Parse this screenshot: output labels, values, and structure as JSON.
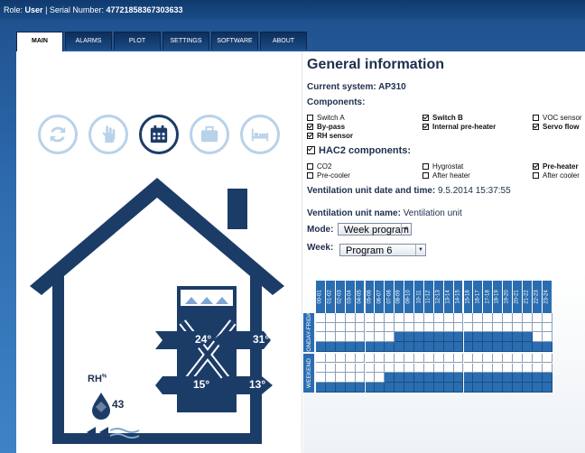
{
  "topbar": {
    "role_label": "Role:",
    "role_value": "User",
    "sep": "|",
    "serial_label": "Serial Number:",
    "serial_value": "47721858367303633"
  },
  "tabs": [
    {
      "label": "MAIN",
      "active": true
    },
    {
      "label": "ALARMS"
    },
    {
      "label": "PLOT"
    },
    {
      "label": "SETTINGS"
    },
    {
      "label": "SOFTWARE"
    },
    {
      "label": "ABOUT"
    }
  ],
  "mode_buttons": [
    {
      "icon": "refresh-icon"
    },
    {
      "icon": "hand-icon"
    },
    {
      "icon": "calendar-icon",
      "active": true
    },
    {
      "icon": "suitcase-icon"
    },
    {
      "icon": "bed-icon"
    }
  ],
  "house": {
    "temp_top_left": "24°",
    "temp_top_right": "31°",
    "temp_bottom_left": "15°",
    "temp_bottom_right": "13°",
    "rh_label": "RH",
    "rh_unit": "%",
    "rh_value": "43"
  },
  "info": {
    "title": "General information",
    "current_system_label": "Current system:",
    "current_system_value": "AP310",
    "components_label": "Components:",
    "components": [
      {
        "label": "Switch A",
        "checked": false
      },
      {
        "label": "Switch B",
        "checked": true
      },
      {
        "label": "VOC sensor",
        "checked": false
      },
      {
        "label": "By-pass",
        "checked": true
      },
      {
        "label": "Internal pre-heater",
        "checked": true
      },
      {
        "label": "Servo flow",
        "checked": true
      },
      {
        "label": "RH sensor",
        "checked": true
      }
    ],
    "hac2_label": "HAC2 components:",
    "hac2_checked": true,
    "hac2": [
      {
        "label": "CO2",
        "checked": false
      },
      {
        "label": "Hygrostat",
        "checked": false
      },
      {
        "label": "Pre-heater",
        "checked": true
      },
      {
        "label": "Pre-cooler",
        "checked": false
      },
      {
        "label": "After heater",
        "checked": false
      },
      {
        "label": "After cooler",
        "checked": false
      }
    ],
    "datetime_label": "Ventilation unit date and time:",
    "datetime_value": "9.5.2014 15:37:55",
    "unitname_label": "Ventilation unit name:",
    "unitname_value": "Ventilation unit",
    "mode_label": "Mode:",
    "mode_value": "Week program",
    "week_label": "Week:",
    "week_value": "Program 6"
  },
  "schedule": {
    "hours": [
      "00-01",
      "01-02",
      "02-03",
      "03-04",
      "04-05",
      "05-06",
      "06-07",
      "07-08",
      "08-09",
      "09-10",
      "10-11",
      "11-12",
      "12-13",
      "13-14",
      "14-15",
      "15-16",
      "16-17",
      "17-18",
      "18-19",
      "19-20",
      "20-21",
      "21-22",
      "22-23",
      "23-24"
    ],
    "weekday_label": "MONDAY-FRIDAY",
    "weekend_label": "WEEKEND",
    "weekday_rows": [
      [
        0,
        0,
        0,
        0,
        0,
        0,
        0,
        0,
        0,
        0,
        0,
        0,
        0,
        0,
        0,
        0,
        0,
        0,
        0,
        0,
        0,
        0,
        0,
        0
      ],
      [
        0,
        0,
        0,
        0,
        0,
        0,
        0,
        0,
        0,
        0,
        0,
        0,
        0,
        0,
        0,
        0,
        0,
        0,
        0,
        0,
        0,
        0,
        0,
        0
      ],
      [
        0,
        0,
        0,
        0,
        0,
        0,
        0,
        0,
        1,
        1,
        1,
        1,
        1,
        1,
        1,
        1,
        1,
        1,
        1,
        1,
        1,
        1,
        0,
        0
      ],
      [
        1,
        1,
        1,
        1,
        1,
        1,
        1,
        1,
        1,
        1,
        1,
        1,
        1,
        1,
        1,
        1,
        1,
        1,
        1,
        1,
        1,
        1,
        1,
        1
      ]
    ],
    "weekend_rows": [
      [
        0,
        0,
        0,
        0,
        0,
        0,
        0,
        0,
        0,
        0,
        0,
        0,
        0,
        0,
        0,
        0,
        0,
        0,
        0,
        0,
        0,
        0,
        0,
        0
      ],
      [
        0,
        0,
        0,
        0,
        0,
        0,
        0,
        0,
        0,
        0,
        0,
        0,
        0,
        0,
        0,
        0,
        0,
        0,
        0,
        0,
        0,
        0,
        0,
        0
      ],
      [
        0,
        0,
        0,
        0,
        0,
        0,
        0,
        1,
        1,
        1,
        1,
        1,
        1,
        1,
        1,
        1,
        1,
        1,
        1,
        1,
        1,
        1,
        1,
        1
      ],
      [
        1,
        1,
        1,
        1,
        1,
        1,
        1,
        1,
        1,
        1,
        1,
        1,
        1,
        1,
        1,
        1,
        1,
        1,
        1,
        1,
        1,
        1,
        1,
        1
      ]
    ]
  },
  "colors": {
    "accent": "#2a6db0",
    "house": "#1c3c68",
    "tabs": "#1b4a84"
  }
}
